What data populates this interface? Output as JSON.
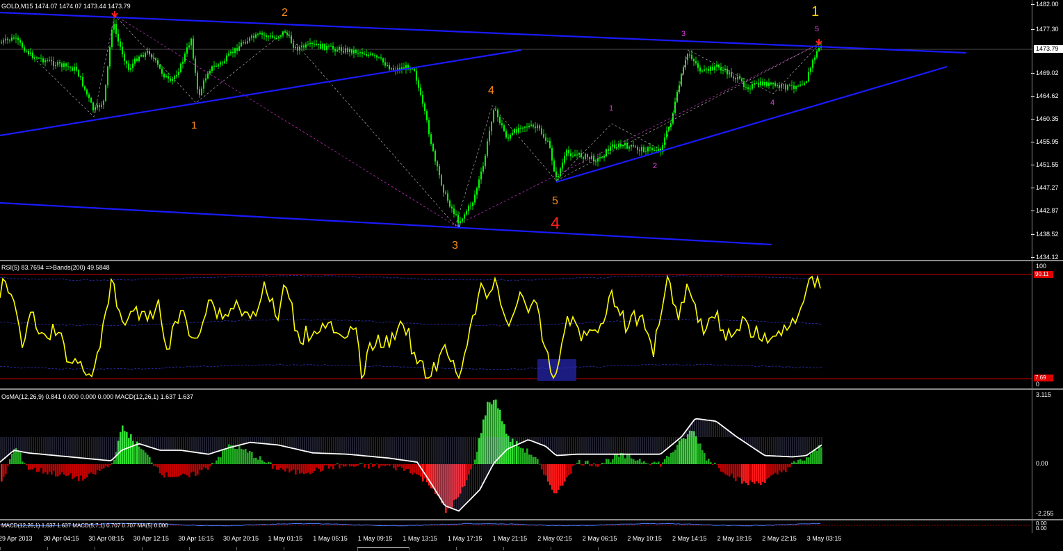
{
  "main": {
    "header": "GOLD,M15  1474.07 1474.07 1473.44 1473.79",
    "current_price": "1473.79",
    "price_axis": [
      "1482.00",
      "1477.30",
      "1473.79",
      "1469.02",
      "1464.62",
      "1460.35",
      "1455.95",
      "1451.55",
      "1447.27",
      "1442.87",
      "1438.52",
      "1434.12"
    ],
    "wave_labels": [
      {
        "text": "1",
        "color": "#ff8c1a"
      },
      {
        "text": "2",
        "color": "#ff8c1a"
      },
      {
        "text": "3",
        "color": "#ff8c1a"
      },
      {
        "text": "4",
        "color": "#ff8c1a"
      },
      {
        "text": "5",
        "color": "#ff8c1a"
      },
      {
        "text": "4",
        "color": "#ff2020"
      },
      {
        "text": "1",
        "color": "#ffd400"
      },
      {
        "text": "1",
        "color": "#e040e0"
      },
      {
        "text": "2",
        "color": "#e040e0"
      },
      {
        "text": "3",
        "color": "#e040e0"
      },
      {
        "text": "4",
        "color": "#e040e0"
      },
      {
        "text": "5",
        "color": "#e040e0"
      }
    ]
  },
  "rsi": {
    "header": "RSI(5) 83.7694  =>Bands(200) 49.5848",
    "axis_top": "100",
    "axis_bottom": "0",
    "upper_value": "90.11",
    "lower_value": "7.69"
  },
  "osma": {
    "header": "OsMA(12,26,9) 0.841 0.000 0.000 0.000  MACD(12,26,1) 1.637 1.637",
    "axis": [
      "3.115",
      "0.00",
      "-2.255"
    ]
  },
  "macd_pane": {
    "header": "MACD(12,26,1) 1.637 1.637 MACD(5,7,1) 0.707 0.707 MA(5) 0.000",
    "axis": [
      "0.00",
      "0.00"
    ]
  },
  "time_axis": [
    "29 Apr 2013",
    "30 Apr 04:15",
    "30 Apr 08:15",
    "30 Apr 12:15",
    "30 Apr 16:15",
    "30 Apr 20:15",
    "1 May 01:15",
    "1 May 05:15",
    "1 May 09:15",
    "1 May 13:15",
    "1 May 17:15",
    "1 May 21:15",
    "2 May 02:15",
    "2 May 06:15",
    "2 May 10:15",
    "2 May 14:15",
    "2 May 18:15",
    "2 May 22:15",
    "3 May 03:15"
  ],
  "colors": {
    "bull": "#00e000",
    "bear": "#00e000",
    "trendline": "#1a1aff",
    "rsi": "#ffff00",
    "osma_pos": "#2ecc2e",
    "osma_neg": "#ff1a1a",
    "macd_line": "#ffffff",
    "bands": "#3030c0",
    "level": "#cc0000"
  },
  "chart_data": [
    {
      "type": "line",
      "title": "GOLD,M15",
      "description_series": "close (approx)",
      "x": [
        "29 Apr 2013",
        "30 Apr 04:15",
        "30 Apr 08:15",
        "30 Apr 12:15",
        "30 Apr 16:15",
        "30 Apr 20:15",
        "1 May 01:15",
        "1 May 05:15",
        "1 May 09:15",
        "1 May 13:15",
        "1 May 17:15",
        "1 May 21:15",
        "2 May 02:15",
        "2 May 06:15",
        "2 May 10:15",
        "2 May 14:15",
        "2 May 18:15",
        "2 May 22:15",
        "3 May 03:15"
      ],
      "y": [
        1476.0,
        1465.5,
        1480.5,
        1472.5,
        1466.0,
        1474.5,
        1478.0,
        1476.0,
        1473.0,
        1454.0,
        1441.5,
        1456.0,
        1449.0,
        1455.5,
        1455.5,
        1472.0,
        1467.0,
        1467.5,
        1473.8
      ],
      "ylim": [
        1434.12,
        1482.0
      ]
    },
    {
      "type": "line",
      "title": "RSI(5)",
      "y": [
        82,
        30,
        35,
        75,
        30,
        70,
        78,
        60,
        55,
        15,
        35,
        88,
        10,
        60,
        70,
        90,
        50,
        45,
        90
      ],
      "ylim": [
        0,
        100
      ]
    },
    {
      "type": "bar",
      "title": "OsMA(12,26,9)",
      "y": [
        0.5,
        -0.4,
        1.0,
        0.6,
        -0.4,
        0.5,
        0.4,
        -0.2,
        -0.2,
        -1.5,
        3.1,
        0.9,
        -1.2,
        0.2,
        0.3,
        1.7,
        -0.5,
        -0.8,
        1.0
      ],
      "ylim": [
        -2.255,
        3.115
      ]
    }
  ]
}
